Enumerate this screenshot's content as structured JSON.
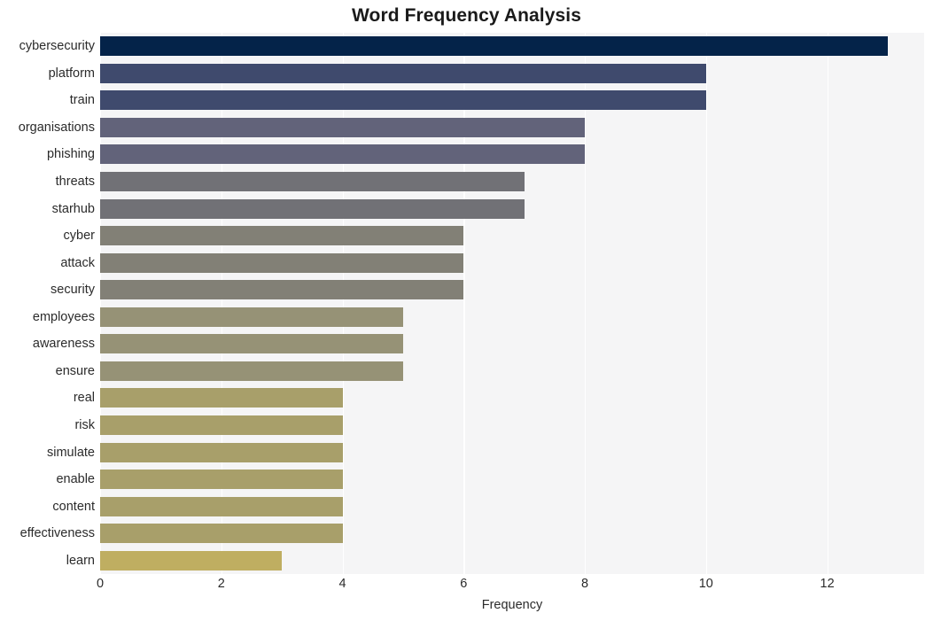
{
  "chart_data": {
    "type": "bar",
    "orientation": "horizontal",
    "title": "Word Frequency Analysis",
    "xlabel": "Frequency",
    "ylabel": "",
    "categories": [
      "cybersecurity",
      "platform",
      "train",
      "organisations",
      "phishing",
      "threats",
      "starhub",
      "cyber",
      "attack",
      "security",
      "employees",
      "awareness",
      "ensure",
      "real",
      "risk",
      "simulate",
      "enable",
      "content",
      "effectiveness",
      "learn"
    ],
    "values": [
      13,
      10,
      10,
      8,
      8,
      7,
      7,
      6,
      6,
      6,
      5,
      5,
      5,
      4,
      4,
      4,
      4,
      4,
      4,
      3
    ],
    "bar_colors": [
      "#042349",
      "#3f4a6d",
      "#3f4a6d",
      "#62637a",
      "#62637a",
      "#717176",
      "#717176",
      "#828076",
      "#828076",
      "#828076",
      "#969276",
      "#969276",
      "#969276",
      "#a89f6a",
      "#a89f6a",
      "#a89f6a",
      "#a89f6a",
      "#a89f6a",
      "#a89f6a",
      "#bfae61"
    ],
    "xlim": [
      0,
      13.6
    ],
    "xticks": [
      0,
      2,
      4,
      6,
      8,
      10,
      12
    ],
    "xtick_labels": [
      "0",
      "2",
      "4",
      "6",
      "8",
      "10",
      "12"
    ],
    "grid": true,
    "grid_axis": "x",
    "grid_color": "#ffffff",
    "plot_background": "#f5f5f6",
    "figure_background": "#ffffff",
    "legend": null,
    "colormap": "cividis"
  }
}
